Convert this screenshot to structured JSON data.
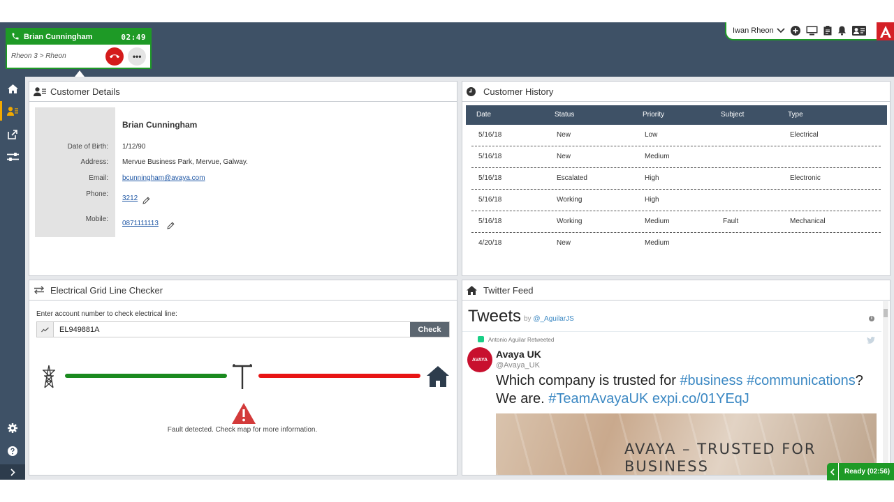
{
  "call": {
    "caller_name": "Brian Cunningham",
    "timer": "02:49",
    "route": "Rheon 3 > Rheon",
    "more_label": "•••"
  },
  "user": {
    "name": "Iwan Rheon"
  },
  "customer_details": {
    "title": "Customer Details",
    "name": "Brian Cunningham",
    "fields": {
      "dob_label": "Date of Birth:",
      "dob": "1/12/90",
      "address_label": "Address:",
      "address": "Mervue Business Park, Mervue, Galway.",
      "email_label": "Email:",
      "email": "bcunningham@avaya.com",
      "phone_label": "Phone:",
      "phone": "3212",
      "mobile_label": "Mobile:",
      "mobile": "0871111113"
    }
  },
  "customer_history": {
    "title": "Customer History",
    "columns": [
      "Date",
      "Status",
      "Priority",
      "Subject",
      "Type"
    ],
    "rows": [
      [
        "5/16/18",
        "New",
        "Low",
        "",
        "Electrical"
      ],
      [
        "5/16/18",
        "New",
        "Medium",
        "",
        ""
      ],
      [
        "5/16/18",
        "Escalated",
        "High",
        "",
        "Electronic"
      ],
      [
        "5/16/18",
        "Working",
        "High",
        "",
        ""
      ],
      [
        "5/16/18",
        "Working",
        "Medium",
        "Fault",
        "Mechanical"
      ],
      [
        "4/20/18",
        "New",
        "Medium",
        "",
        ""
      ]
    ]
  },
  "grid_checker": {
    "title": "Electrical Grid Line Checker",
    "prompt": "Enter account number to check electrical line:",
    "account_value": "EL949881A",
    "check_label": "Check",
    "fault_message": "Fault detected. Check map for more information.",
    "status_colors": {
      "ok": "#1a8a1f",
      "fault": "#e81414"
    }
  },
  "twitter": {
    "title": "Twitter Feed",
    "feed_title": "Tweets",
    "by_label": "by",
    "by_handle": "@_AguilarJS",
    "retweet_label": "Antonio Aguilar Retweeted",
    "tweet": {
      "avatar_text": "AVAYA",
      "name": "Avaya UK",
      "handle": "@Avaya_UK",
      "text_plain_1": "Which company is trusted for ",
      "tag_business": "#business",
      "tag_communications": "#communications",
      "text_plain_2": "?",
      "text_plain_3": "We are. ",
      "tag_team": "#TeamAvayaUK",
      "link": "expi.co/01YEqJ",
      "image_text_1": "AVAYA – TRUSTED FOR",
      "image_text_2": "BUSINESS"
    }
  },
  "ready": {
    "label": "Ready (02:56)"
  },
  "colors": {
    "nav": "#3e5166",
    "accent_green": "#1e9a26",
    "brand_red": "#d42027",
    "active_marker": "#f2a900"
  }
}
